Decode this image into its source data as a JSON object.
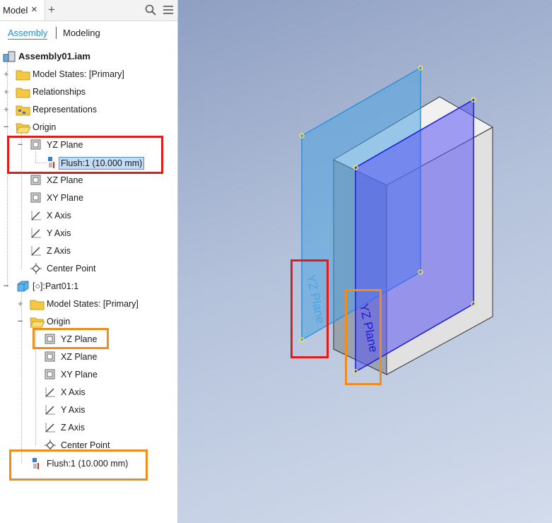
{
  "header": {
    "tab_label": "Model",
    "close_glyph": "×",
    "add_glyph": "+",
    "icons": [
      "search-icon",
      "menu-icon"
    ]
  },
  "subtabs": {
    "assembly": "Assembly",
    "modeling": "Modeling"
  },
  "tree": {
    "root": "Assembly01.iam",
    "model_states": "Model States: [Primary]",
    "relationships": "Relationships",
    "representations": "Representations",
    "origin": "Origin",
    "yz_plane": "YZ Plane",
    "flush_child": "Flush:1 (10.000 mm)",
    "xz_plane": "XZ Plane",
    "xy_plane": "XY Plane",
    "x_axis": "X Axis",
    "y_axis": "Y Axis",
    "z_axis": "Z Axis",
    "center_point": "Center Point",
    "part": "[○]:Part01:1",
    "part_children": {
      "model_states": "Model States: [Primary]",
      "origin": "Origin",
      "yz_plane": "YZ Plane",
      "xz_plane": "XZ Plane",
      "xy_plane": "XY Plane",
      "x_axis": "X Axis",
      "y_axis": "Y Axis",
      "z_axis": "Z Axis",
      "center_point": "Center Point"
    },
    "flush": "Flush:1 (10.000 mm)"
  },
  "viewport": {
    "plane_label_light": "YZ Plane",
    "plane_label_dark": "YZ Plane"
  },
  "colors": {
    "highlight_red": "#e21b1b",
    "highlight_orange": "#f08c1c",
    "selection": "#c3dcf7",
    "light_plane": "#4fa3e0",
    "dark_plane": "#1a1adb",
    "active_tab": "#1a8fd0"
  }
}
